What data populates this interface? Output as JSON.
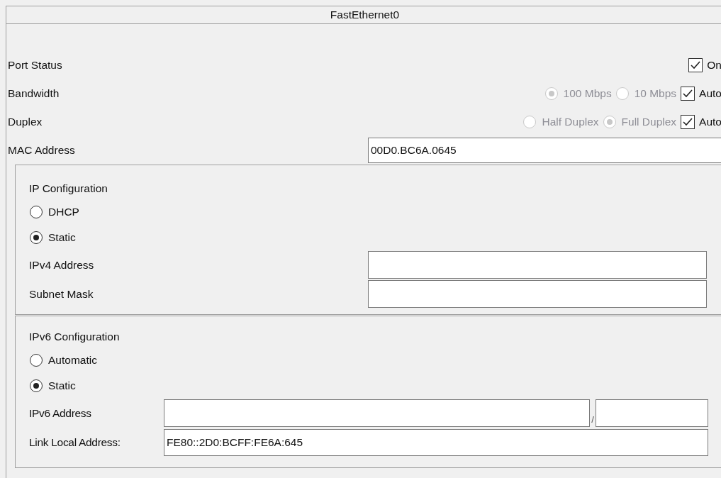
{
  "panel": {
    "title": "FastEthernet0"
  },
  "port_status": {
    "label": "Port Status",
    "toggle": {
      "label": "On",
      "checked": true
    }
  },
  "bandwidth": {
    "label": "Bandwidth",
    "disabled": true,
    "options": [
      {
        "label": "100 Mbps",
        "selected": true
      },
      {
        "label": "10 Mbps",
        "selected": false
      }
    ],
    "auto": {
      "label": "Auto",
      "checked": true
    }
  },
  "duplex": {
    "label": "Duplex",
    "disabled": true,
    "options": [
      {
        "label": "Half Duplex",
        "selected": false
      },
      {
        "label": "Full Duplex",
        "selected": true
      }
    ],
    "auto": {
      "label": "Auto",
      "checked": true
    }
  },
  "mac_address": {
    "label": "MAC Address",
    "value": "00D0.BC6A.0645"
  },
  "ip_configuration": {
    "title": "IP Configuration",
    "modes": [
      {
        "label": "DHCP",
        "selected": false
      },
      {
        "label": "Static",
        "selected": true
      }
    ],
    "fields": [
      {
        "label": "IPv4 Address"
      },
      {
        "label": "Subnet Mask"
      }
    ]
  },
  "ipv6_configuration": {
    "title": "IPv6 Configuration",
    "modes": [
      {
        "label": "Automatic",
        "selected": false
      },
      {
        "label": "Static",
        "selected": true
      }
    ],
    "address": {
      "label": "IPv6 Address",
      "separator": "/"
    },
    "link_local": {
      "label": "Link Local Address:",
      "value": "FE80::2D0:BCFF:FE6A:645"
    }
  }
}
